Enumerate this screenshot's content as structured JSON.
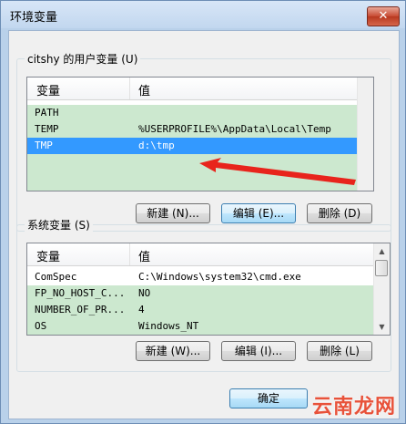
{
  "window": {
    "title": "环境变量",
    "close_glyph": "✕"
  },
  "user_vars": {
    "label": "citshy 的用户变量 (U)",
    "columns": [
      "变量",
      "值"
    ],
    "rows": [
      {
        "name": "PATH",
        "value": ""
      },
      {
        "name": "TEMP",
        "value": "%USERPROFILE%\\AppData\\Local\\Temp"
      },
      {
        "name": "TMP",
        "value": "d:\\tmp"
      }
    ],
    "selected_row": 2,
    "buttons": {
      "new": "新建 (N)...",
      "edit": "编辑 (E)...",
      "delete": "删除 (D)"
    }
  },
  "system_vars": {
    "label": "系统变量 (S)",
    "columns": [
      "变量",
      "值"
    ],
    "rows": [
      {
        "name": "ComSpec",
        "value": "C:\\Windows\\system32\\cmd.exe"
      },
      {
        "name": "FP_NO_HOST_C...",
        "value": "NO"
      },
      {
        "name": "NUMBER_OF_PR...",
        "value": "4"
      },
      {
        "name": "OS",
        "value": "Windows_NT"
      }
    ],
    "buttons": {
      "new": "新建 (W)...",
      "edit": "编辑 (I)...",
      "delete": "删除 (L)"
    }
  },
  "footer": {
    "ok": "确定"
  },
  "annotation": {
    "color": "#e8241c"
  },
  "watermark": {
    "text": "云南龙网"
  }
}
